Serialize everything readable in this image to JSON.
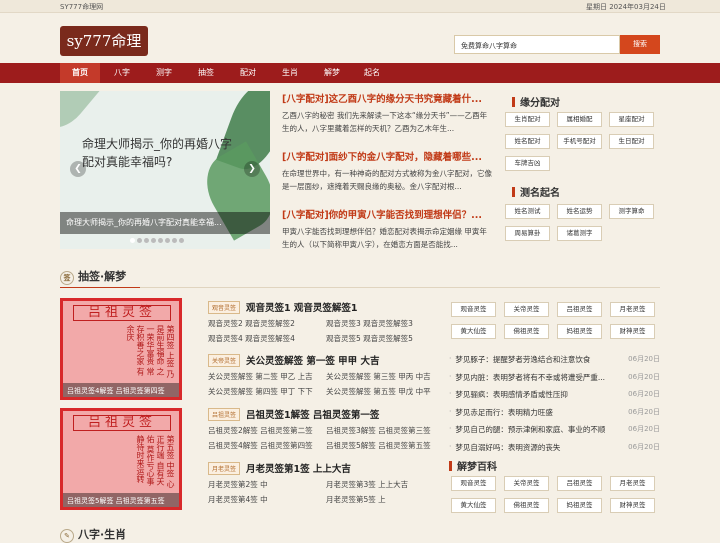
{
  "topbar": {
    "site": "SY777命理网",
    "date": "星期日  2024年03月24日"
  },
  "header": {
    "logo": "sy777命理网",
    "search_value": "免费算命八字算命",
    "search_button": "搜索"
  },
  "nav": {
    "items": [
      "首页",
      "八字",
      "测字",
      "抽签",
      "配对",
      "生肖",
      "解梦",
      "起名"
    ],
    "active": 0
  },
  "slider": {
    "text": "命理大师揭示_你的再婚八字配对真能幸福吗?",
    "caption": "命理大师揭示_你的再婚八字配对真能幸福...",
    "dots": 8,
    "active_dot": 0
  },
  "news": [
    {
      "title": "[八字配对]这乙酉八字的缘分天书究竟藏着什...",
      "desc": "乙酉八字的秘密 我们先来解读一下这本“缘分天书”——乙酉年生的人，八字里藏着怎样的天机？乙酉为乙木年生..."
    },
    {
      "title": "[八字配对]面纱下的金八字配对，隐藏着哪些...",
      "desc": "在命理世界中，有一种神奇的配对方式被称为金八字配对，它像是一层面纱，遮掩着天赐良缘的奥秘。金八字配对根..."
    },
    {
      "title": "[八字配对]你的甲寅八字能否找到理想伴侣？...",
      "desc": "甲寅八字能否找到理想伴侣？婚恋配对表揭示命定姻缘 甲寅年生的人（以下简称甲寅八字），在婚恋方面是否能找..."
    }
  ],
  "yuanfen": {
    "title": "缘分配对",
    "tags": [
      "生肖配对",
      "属相婚配",
      "星座配对",
      "姓名配对",
      "手机号配对",
      "生日配对",
      "车牌吉凶"
    ]
  },
  "naming": {
    "title": "测名起名",
    "tags": [
      "姓名测试",
      "姓名运势",
      "测字算命",
      "周易算卦",
      "诸葛测字"
    ]
  },
  "choujian": {
    "title": "抽签·解梦",
    "icon": "签",
    "sticks": [
      {
        "title": "吕祖灵签",
        "cols": "第四签 上签 乃是前生福命 之一荣华富贵 常存积善之家 有余庆",
        "caption": "吕祖灵签4解签 吕祖灵签第四签"
      },
      {
        "title": "吕祖灵签",
        "cols": "第五签 中签 心正行端 自有天佑 莫作亏心事 静待时来运转",
        "caption": "吕祖灵签5解签 吕祖灵签第五签"
      }
    ],
    "groups": [
      {
        "tag": "观音灵签",
        "title": "观音灵签1 观音灵签解签1",
        "rows": [
          [
            "观音灵签2 观音灵签解签2",
            "观音灵签3 观音灵签解签3"
          ],
          [
            "观音灵签4 观音灵签解签4",
            "观音灵签5 观音灵签解签5"
          ]
        ]
      },
      {
        "tag": "关帝灵签",
        "title": "关公灵签解签 第一签 甲甲 大吉",
        "rows": [
          [
            "关公灵签解签 第二签 甲乙 上吉",
            "关公灵签解签 第三签 甲丙 中吉"
          ],
          [
            "关公灵签解签 第四签 甲丁 下下",
            "关公灵签解签 第五签 甲戊 中平"
          ]
        ]
      },
      {
        "tag": "吕祖灵签",
        "title": "吕祖灵签1解签 吕祖灵签第一签",
        "rows": [
          [
            "吕祖灵签2解签 吕祖灵签第二签",
            "吕祖灵签3解签 吕祖灵签第三签"
          ],
          [
            "吕祖灵签4解签 吕祖灵签第四签",
            "吕祖灵签5解签 吕祖灵签第五签"
          ]
        ]
      },
      {
        "tag": "月老灵签",
        "title": "月老灵签第1签 上上大吉",
        "rows": [
          [
            "月老灵签第2签 中",
            "月老灵签第3签 上上大吉"
          ],
          [
            "月老灵签第4签 中",
            "月老灵签第5签 上"
          ]
        ]
      }
    ],
    "right_tags": [
      "观音灵签",
      "关帝灵签",
      "吕祖灵签",
      "月老灵签",
      "黄大仙签",
      "佛祖灵签",
      "妈祖灵签",
      "财神灵签"
    ],
    "dreams": [
      {
        "t": "梦见豚子：提醒梦者劳逸结合和注意饮食",
        "d": "06月20日"
      },
      {
        "t": "梦见内脏：表明梦者将有不幸或将遭受严重...",
        "d": "06月20日"
      },
      {
        "t": "梦见骊疯：表明感情矛盾或性压抑",
        "d": "06月20日"
      },
      {
        "t": "梦见赤足而行：表明精力旺盛",
        "d": "06月20日"
      },
      {
        "t": "梦见自己的腿：预示津俐和家庭、事业的不顺",
        "d": "06月20日"
      },
      {
        "t": "梦见自溺好吗：表明资源的丧失",
        "d": "06月20日"
      }
    ]
  },
  "baike": {
    "title": "解梦百科",
    "tags": [
      "观音灵签",
      "关帝灵签",
      "吕祖灵签",
      "月老灵签",
      "黄大仙签",
      "佛祖灵签",
      "妈祖灵签",
      "财神灵签"
    ]
  },
  "bazi": {
    "title": "八字·生肖"
  },
  "colors": {
    "nav": "#9d1c1c",
    "accent": "#c13a17"
  }
}
